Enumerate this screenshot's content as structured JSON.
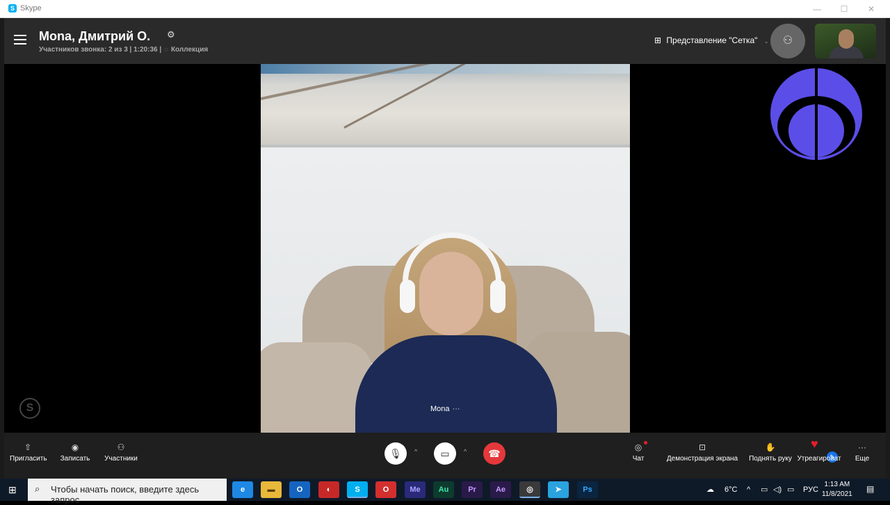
{
  "window": {
    "app_name": "Skype",
    "controls": {
      "minimize": "—",
      "maximize": "☐",
      "close": "✕"
    }
  },
  "header": {
    "title": "Mona, Дмитрий О.",
    "subtitle": "Участников звонка: 2 из 3 | 1:20:36 |",
    "collection_label": "Коллекция",
    "grid_view_label": "Представление \"Сетка\"",
    "icons": {
      "menu": "hamburger-icon",
      "settings": "gear-icon",
      "add_participant": "add-person-icon"
    }
  },
  "stage": {
    "participant_name": "Mona",
    "participant_more": "···",
    "watermark": "S"
  },
  "controls": {
    "invite": "Пригласить",
    "record": "Записать",
    "participants": "Участники",
    "chat": "Чат",
    "screen_share": "Демонстрация экрана",
    "raise_hand": "Поднять руку",
    "react": "Утреагироват",
    "more": "Еще",
    "colors": {
      "end_call": "#e5383b",
      "heart": "#e81d2a",
      "accent": "#5b4ee8"
    }
  },
  "taskbar": {
    "search_placeholder": "Чтобы начать поиск, введите здесь запрос",
    "apps": [
      "Me",
      "Au",
      "Pr",
      "Ae",
      "Ps"
    ],
    "weather": "6°C",
    "language": "РУС",
    "time": "1:13 AM",
    "date": "11/8/2021"
  }
}
